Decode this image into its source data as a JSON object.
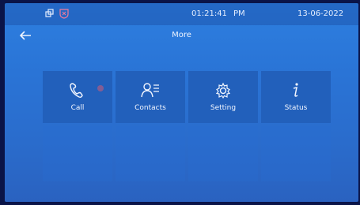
{
  "statusbar": {
    "time": "01:21:41",
    "ampm": "PM",
    "date": "13-06-2022",
    "icons": [
      "windows-icon",
      "shield-icon"
    ]
  },
  "header": {
    "title": "More",
    "back_icon": "back-arrow-icon"
  },
  "menu": {
    "items": [
      {
        "label": "Call",
        "icon": "phone-icon"
      },
      {
        "label": "Contacts",
        "icon": "contacts-icon"
      },
      {
        "label": "Setting",
        "icon": "gear-icon"
      },
      {
        "label": "Status",
        "icon": "info-icon"
      }
    ]
  },
  "colors": {
    "screen_bg": "#2a74d6",
    "tile_bg": "#2260bb",
    "text": "#f2f6ff"
  }
}
